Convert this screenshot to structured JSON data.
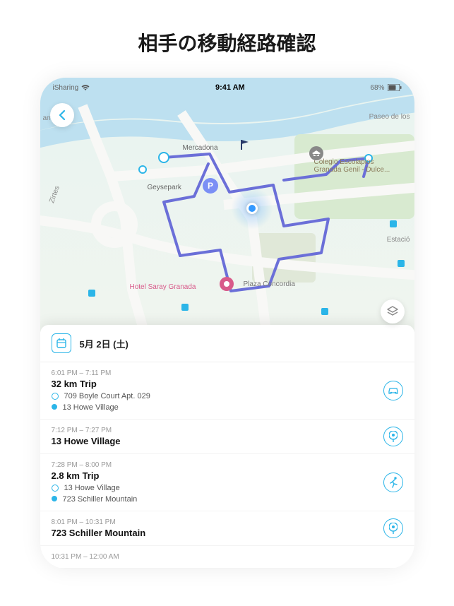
{
  "page": {
    "title": "相手の移動経路確認"
  },
  "statusBar": {
    "carrier": "iSharing",
    "time": "9:41 AM",
    "battery": "68%"
  },
  "map": {
    "labels": {
      "mercadona": "Mercadona",
      "geysepark": "Geysepark",
      "hotel": "Hotel Saray Granada",
      "plaza": "Plaza Concordia",
      "school": "Colegio Escolapios Granada Genil - Dulce...",
      "paseo": "Paseo de los",
      "zirtes": "Zirtes",
      "amar": "amar",
      "estacio": "Estació",
      "parking": "P"
    }
  },
  "dateHeader": {
    "date": "5月 2日 (土)"
  },
  "timeline": [
    {
      "time": "6:01 PM – 7:11 PM",
      "title": "32 km Trip",
      "from": "709 Boyle Court Apt. 029",
      "to": "13 Howe Village",
      "icon": "car"
    },
    {
      "time": "7:12 PM – 7:27 PM",
      "title": "13 Howe Village",
      "icon": "pin"
    },
    {
      "time": "7:28 PM – 8:00 PM",
      "title": "2.8 km Trip",
      "from": "13 Howe Village",
      "to": "723 Schiller Mountain",
      "icon": "run"
    },
    {
      "time": "8:01 PM – 10:31 PM",
      "title": "723 Schiller Mountain",
      "icon": "pin"
    },
    {
      "time": "10:31 PM – 12:00 AM",
      "title": ""
    }
  ]
}
